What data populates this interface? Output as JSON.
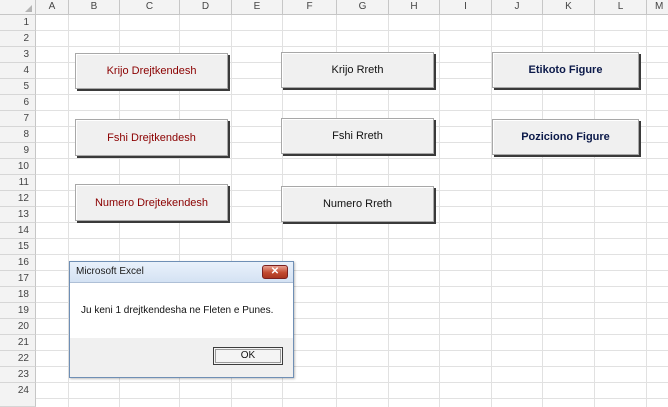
{
  "spreadsheet": {
    "columns": [
      "A",
      "B",
      "C",
      "D",
      "E",
      "F",
      "G",
      "H",
      "I",
      "J",
      "K",
      "L",
      "M"
    ],
    "rows": [
      "1",
      "2",
      "3",
      "4",
      "5",
      "6",
      "7",
      "8",
      "9",
      "10",
      "11",
      "12",
      "13",
      "14",
      "15",
      "16",
      "17",
      "18",
      "19",
      "20",
      "21",
      "22",
      "23",
      "24"
    ]
  },
  "buttons": {
    "krijo_drejtkendesh": "Krijo Drejtkendesh",
    "fshi_drejtkendesh": "Fshi Drejtkendesh",
    "numero_drejtekendesh": "Numero Drejtekendesh",
    "krijo_rreth": "Krijo Rreth",
    "fshi_rreth": "Fshi Rreth",
    "numero_rreth": "Numero Rreth",
    "etikoto_figure": "Etikoto Figure",
    "poziciono_figure": "Poziciono Figure"
  },
  "dialog": {
    "title": "Microsoft Excel",
    "close_glyph": "✕",
    "message": "Ju keni 1 drejtkendesha ne Fleten e Punes.",
    "ok_label": "OK"
  },
  "colors": {
    "dark_red_text": "#8b0000",
    "navy_text": "#0c1a4a",
    "close_button": "#c24a30"
  }
}
